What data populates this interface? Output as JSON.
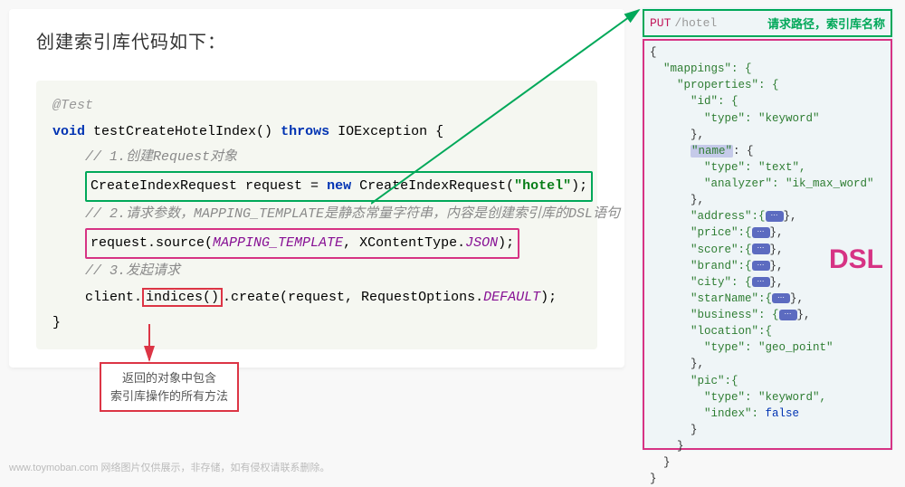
{
  "heading": "创建索引库代码如下：",
  "code": {
    "annotation": "@Test",
    "signature_kw1": "void",
    "signature_name": "testCreateHotelIndex()",
    "signature_kw2": "throws",
    "signature_exc": "IOException",
    "brace_open": "{",
    "comment1": "// 1.创建Request对象",
    "line1_class": "CreateIndexRequest",
    "line1_var": "request = ",
    "line1_new": "new",
    "line1_ctor": " CreateIndexRequest(",
    "line1_arg": "\"hotel\"",
    "line1_end": ");",
    "comment2": "// 2.请求参数，MAPPING_TEMPLATE是静态常量字符串，内容是创建索引库的DSL语句",
    "line2_obj": "request.source(",
    "line2_arg1": "MAPPING_TEMPLATE",
    "line2_sep": ", XContentType.",
    "line2_arg2": "JSON",
    "line2_end": ");",
    "comment3": "// 3.发起请求",
    "line3_client": "client.",
    "line3_indices": "indices()",
    "line3_create": ".create(request, RequestOptions.",
    "line3_default": "DEFAULT",
    "line3_end": ");",
    "brace_close": "}"
  },
  "request": {
    "method": "PUT",
    "path": "/hotel",
    "caption": "请求路径，索引库名称"
  },
  "json": {
    "l0": "{",
    "l1": "  \"mappings\": {",
    "l2": "    \"properties\": {",
    "l3": "      \"id\": {",
    "l4": "        \"type\": \"keyword\"",
    "l5": "      },",
    "l6a": "      ",
    "l6_name": "\"name\"",
    "l6b": ": {",
    "l7": "        \"type\": \"text\",",
    "l8": "        \"analyzer\": \"ik_max_word\"",
    "l9": "      },",
    "l10": "      \"address\":{",
    "l10b": "},",
    "l11": "      \"price\":{",
    "l12": "      \"score\":{",
    "l13": "      \"brand\":{",
    "l14": "      \"city\": {",
    "l15": "      \"starName\":{",
    "l16": "      \"business\": {",
    "l17": "      \"location\":{",
    "l18": "        \"type\": \"geo_point\"",
    "l19": "      },",
    "l20": "      \"pic\":{",
    "l21": "        \"type\": \"keyword\",",
    "l22a": "        \"index\": ",
    "l22b": "false",
    "l23": "      }",
    "l24": "    }",
    "l25": "  }",
    "l26": "}"
  },
  "dsl_label": "DSL",
  "callout": {
    "line1": "返回的对象中包含",
    "line2": "索引库操作的所有方法"
  },
  "watermark": "www.toymoban.com 网络图片仅供展示，非存储，如有侵权请联系删除。"
}
